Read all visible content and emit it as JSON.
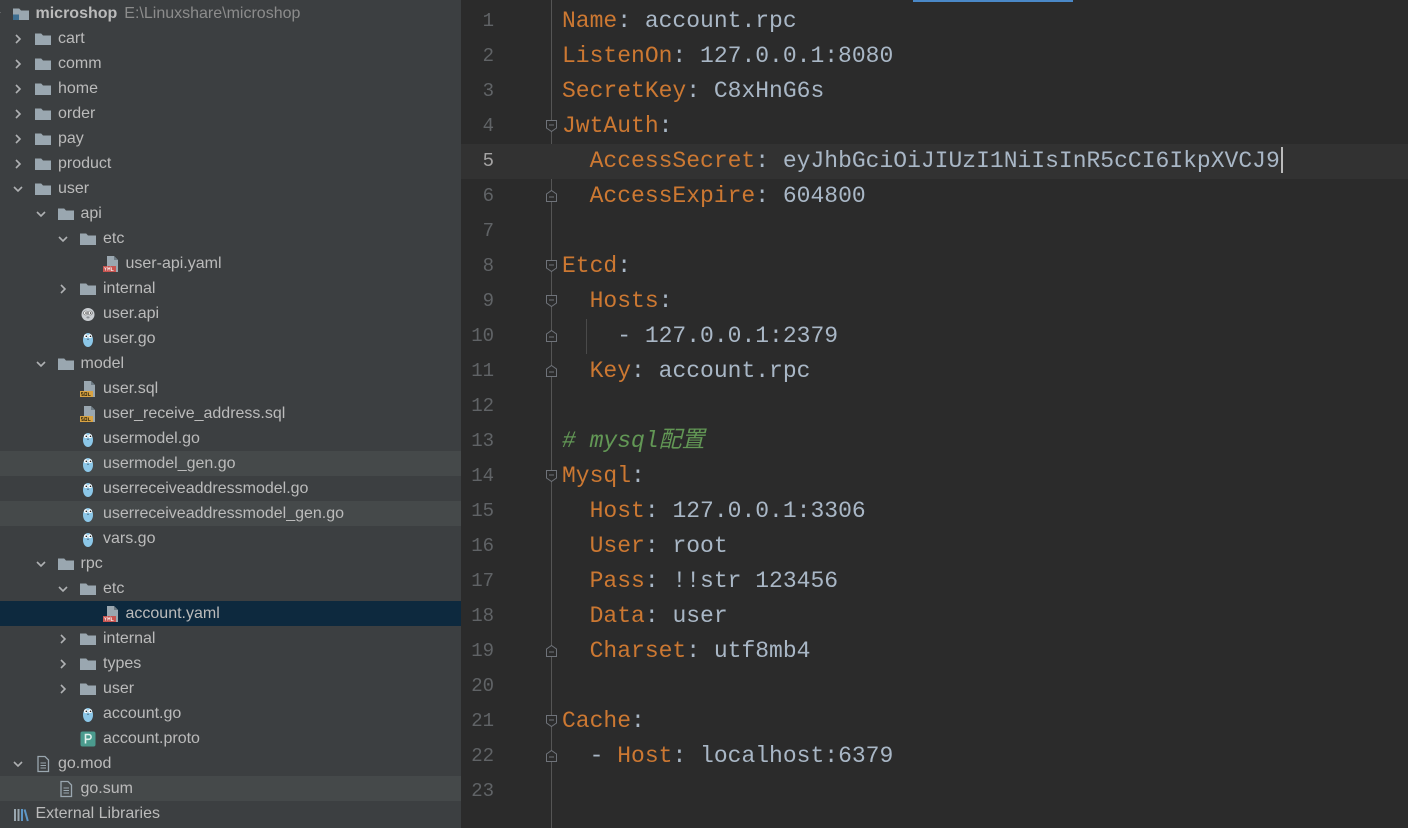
{
  "theme": {
    "tree_bg": "#3c3f41",
    "editor_bg": "#2b2b2b",
    "selection_bg": "#0d293e",
    "tinted_row_bg": "#45494a",
    "current_line_bg": "#323232",
    "key": "#cc7832",
    "value": "#a9b7c6",
    "comment": "#629755",
    "line_number": "#606366",
    "current_line_number": "#a4a3a3",
    "tree_text": "#bbbbbb",
    "tree_path": "#8c8c8c",
    "accent": "#4a88c7"
  },
  "project_tree": [
    {
      "label": "microshop",
      "path": "E:\\Linuxshare\\microshop",
      "icon": "module-folder-icon",
      "expanded": true,
      "children": [
        {
          "label": "cart",
          "icon": "folder-icon",
          "expanded": false
        },
        {
          "label": "comm",
          "icon": "folder-icon",
          "expanded": false
        },
        {
          "label": "home",
          "icon": "folder-icon",
          "expanded": false
        },
        {
          "label": "order",
          "icon": "folder-icon",
          "expanded": false
        },
        {
          "label": "pay",
          "icon": "folder-icon",
          "expanded": false
        },
        {
          "label": "product",
          "icon": "folder-icon",
          "expanded": false
        },
        {
          "label": "user",
          "icon": "folder-icon",
          "expanded": true,
          "children": [
            {
              "label": "api",
              "icon": "folder-icon",
              "expanded": true,
              "children": [
                {
                  "label": "etc",
                  "icon": "folder-icon",
                  "expanded": true,
                  "children": [
                    {
                      "label": "user-api.yaml",
                      "icon": "yaml-file-icon"
                    }
                  ]
                },
                {
                  "label": "internal",
                  "icon": "folder-icon",
                  "expanded": false
                },
                {
                  "label": "user.api",
                  "icon": "api-file-icon"
                },
                {
                  "label": "user.go",
                  "icon": "go-file-icon"
                }
              ]
            },
            {
              "label": "model",
              "icon": "folder-icon",
              "expanded": true,
              "children": [
                {
                  "label": "user.sql",
                  "icon": "sql-file-icon"
                },
                {
                  "label": "user_receive_address.sql",
                  "icon": "sql-file-icon"
                },
                {
                  "label": "usermodel.go",
                  "icon": "go-file-icon"
                },
                {
                  "label": "usermodel_gen.go",
                  "icon": "go-file-icon",
                  "tinted": true
                },
                {
                  "label": "userreceiveaddressmodel.go",
                  "icon": "go-file-icon"
                },
                {
                  "label": "userreceiveaddressmodel_gen.go",
                  "icon": "go-file-icon",
                  "tinted": true
                },
                {
                  "label": "vars.go",
                  "icon": "go-file-icon"
                }
              ]
            },
            {
              "label": "rpc",
              "icon": "folder-icon",
              "expanded": true,
              "children": [
                {
                  "label": "etc",
                  "icon": "folder-icon",
                  "expanded": true,
                  "children": [
                    {
                      "label": "account.yaml",
                      "icon": "yaml-file-icon",
                      "selected": true
                    }
                  ]
                },
                {
                  "label": "internal",
                  "icon": "folder-icon",
                  "expanded": false
                },
                {
                  "label": "types",
                  "icon": "folder-icon",
                  "expanded": false
                },
                {
                  "label": "user",
                  "icon": "folder-icon",
                  "expanded": false
                },
                {
                  "label": "account.go",
                  "icon": "go-file-icon"
                },
                {
                  "label": "account.proto",
                  "icon": "proto-file-icon"
                }
              ]
            }
          ]
        },
        {
          "label": "go.mod",
          "icon": "text-file-icon",
          "expanded": true,
          "children": [
            {
              "label": "go.sum",
              "icon": "text-file-icon",
              "tinted": true
            }
          ]
        }
      ]
    },
    {
      "label": "External Libraries",
      "icon": "external-libraries-icon",
      "expanded": false
    }
  ],
  "editor": {
    "lines": [
      {
        "n": "1",
        "key": "Name",
        "sep": ": ",
        "value": "account.rpc"
      },
      {
        "n": "2",
        "key": "ListenOn",
        "sep": ": ",
        "value": "127.0.0.1:8080"
      },
      {
        "n": "3",
        "key": "SecretKey",
        "sep": ": ",
        "value": "C8xHnG6s"
      },
      {
        "n": "4",
        "key": "JwtAuth",
        "sep": ":",
        "fold_icon": "fold-start-icon"
      },
      {
        "n": "5",
        "indent": "  ",
        "key": "AccessSecret",
        "sep": ": ",
        "value": "eyJhbGciOiJIUzI1NiIsInR5cCI6IkpXVCJ9",
        "current": true,
        "caret": true
      },
      {
        "n": "6",
        "indent": "  ",
        "key": "AccessExpire",
        "sep": ": ",
        "value": "604800",
        "fold_icon": "fold-end-icon"
      },
      {
        "n": "7"
      },
      {
        "n": "8",
        "key": "Etcd",
        "sep": ":",
        "fold_icon": "fold-start-icon"
      },
      {
        "n": "9",
        "indent": "  ",
        "key": "Hosts",
        "sep": ":",
        "fold_icon": "fold-start-icon"
      },
      {
        "n": "10",
        "indent": "    ",
        "dash": "- ",
        "value": "127.0.0.1:2379",
        "fold_icon": "fold-end-icon"
      },
      {
        "n": "11",
        "indent": "  ",
        "key": "Key",
        "sep": ": ",
        "value": "account.rpc",
        "fold_icon": "fold-end-icon"
      },
      {
        "n": "12"
      },
      {
        "n": "13",
        "comment": "# mysql配置"
      },
      {
        "n": "14",
        "key": "Mysql",
        "sep": ":",
        "fold_icon": "fold-start-icon"
      },
      {
        "n": "15",
        "indent": "  ",
        "key": "Host",
        "sep": ": ",
        "value": "127.0.0.1:3306"
      },
      {
        "n": "16",
        "indent": "  ",
        "key": "User",
        "sep": ": ",
        "value": "root"
      },
      {
        "n": "17",
        "indent": "  ",
        "key": "Pass",
        "sep": ": ",
        "value": "!!str 123456"
      },
      {
        "n": "18",
        "indent": "  ",
        "key": "Data",
        "sep": ": ",
        "value": "user"
      },
      {
        "n": "19",
        "indent": "  ",
        "key": "Charset",
        "sep": ": ",
        "value": "utf8mb4",
        "fold_icon": "fold-end-icon"
      },
      {
        "n": "20"
      },
      {
        "n": "21",
        "key": "Cache",
        "sep": ":",
        "fold_icon": "fold-start-icon"
      },
      {
        "n": "22",
        "indent": "  ",
        "dash": "- ",
        "key": "Host",
        "sep": ": ",
        "value": "localhost:6379",
        "fold_icon": "fold-end-icon"
      },
      {
        "n": "23"
      }
    ]
  }
}
